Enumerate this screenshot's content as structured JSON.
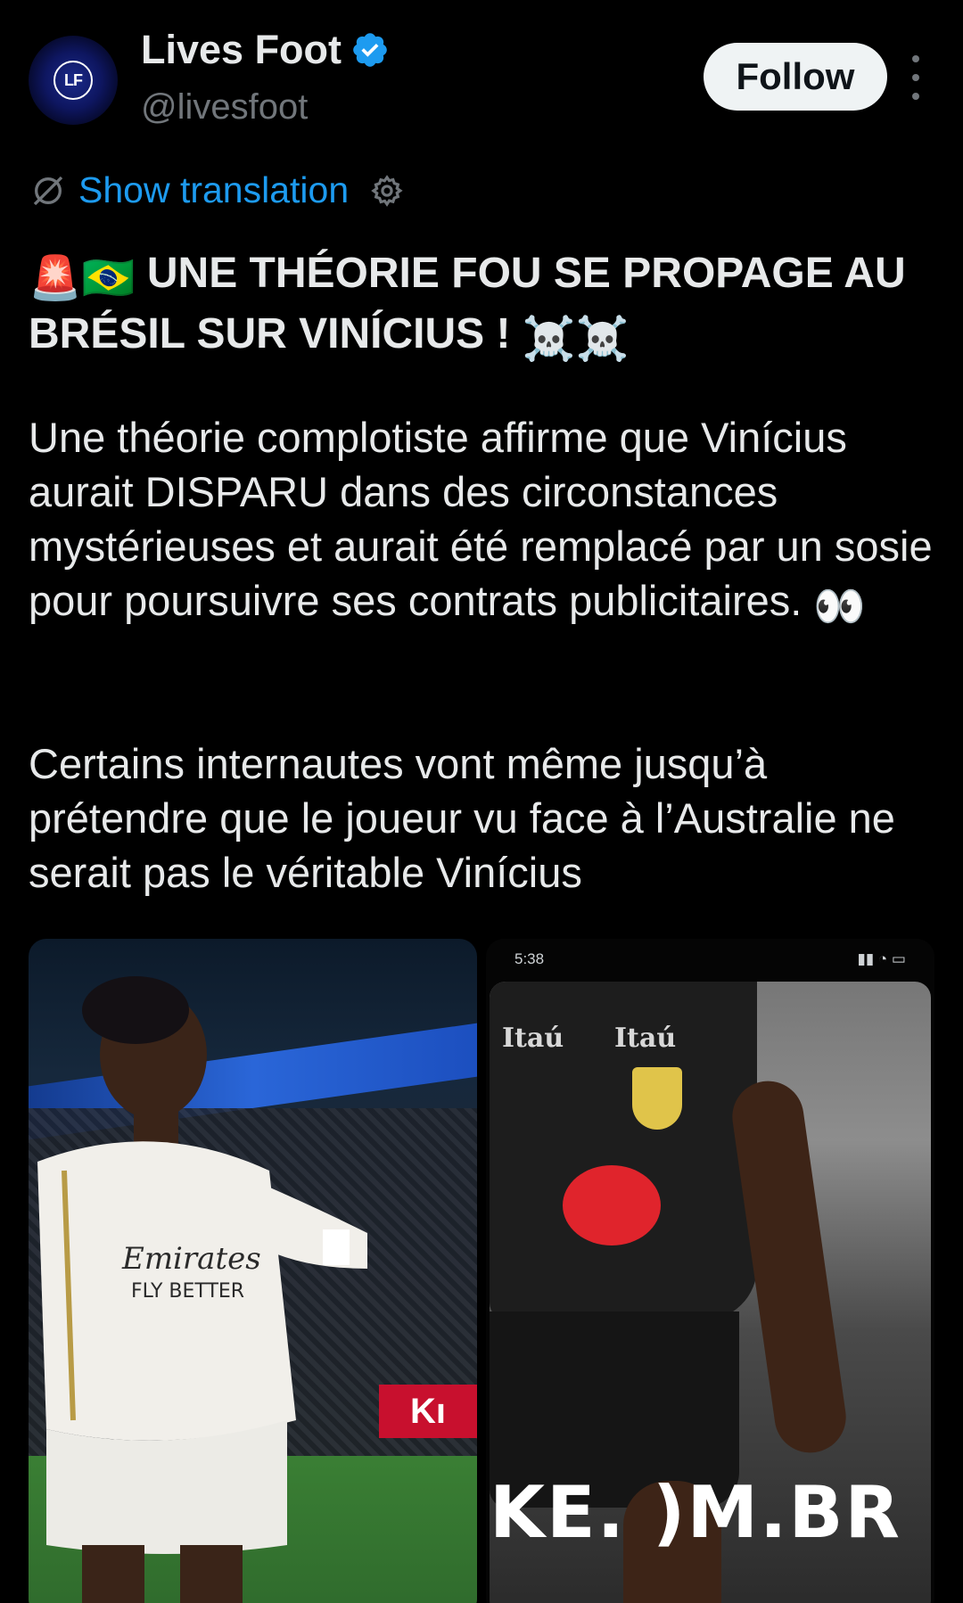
{
  "author": {
    "display_name": "Lives Foot",
    "handle": "@livesfoot",
    "avatar_text": "LF"
  },
  "actions": {
    "follow_label": "Follow"
  },
  "translation": {
    "label": "Show translation"
  },
  "tweet": {
    "headline": "UNE THÉORIE FOU SE PROPAGE AU BRÉSIL SUR VINÍCIUS !",
    "paragraph_1": "Une théorie complotiste affirme que Vinícius aurait DISPARU dans des circonstances mystérieuses et aurait été remplacé par un sosie pour poursuivre ses contrats publicitaires.",
    "paragraph_2": "Certains internautes vont même jusqu’à prétendre que le joueur vu face à l’Australie ne serait pas le véritable Vinícius"
  },
  "media": {
    "left_ad_text": "Kı",
    "right_status_time": "5:38",
    "right_sponsor_1": "Itaú",
    "right_sponsor_2": "Itaú",
    "right_board_text": "KE. )M.BR"
  },
  "colors": {
    "background": "#000000",
    "text": "#e7e9ea",
    "secondary": "#71767b",
    "link": "#1d9bf0",
    "verified": "#1d9bf0",
    "follow_bg": "#eff3f4"
  }
}
